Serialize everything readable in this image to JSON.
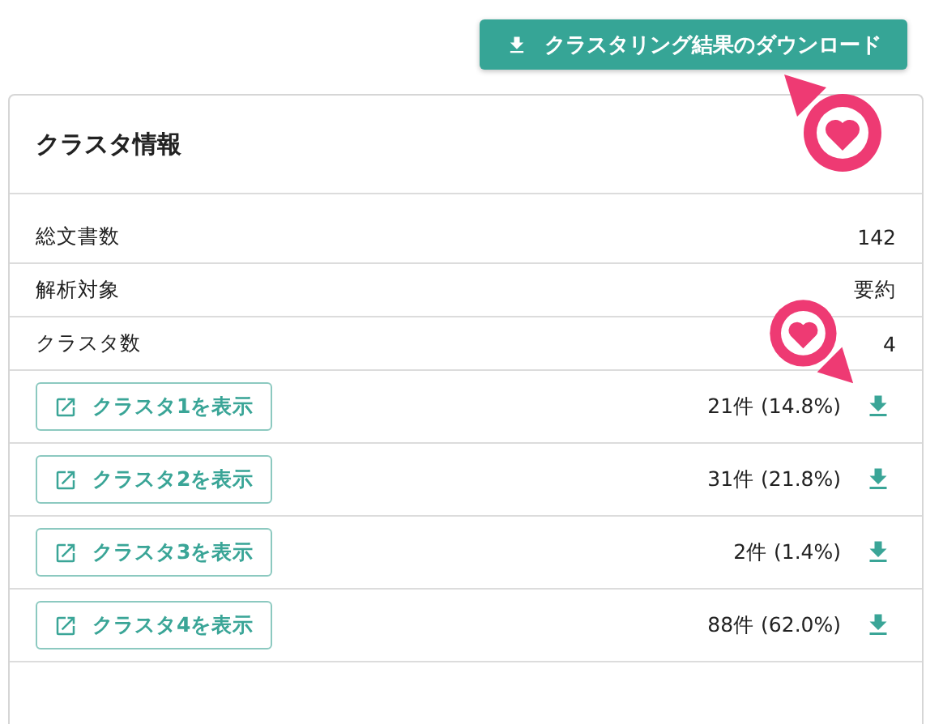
{
  "download_button": {
    "label": "クラスタリング結果のダウンロード"
  },
  "card": {
    "title": "クラスタ情報",
    "info_rows": [
      {
        "label": "総文書数",
        "value": "142"
      },
      {
        "label": "解析対象",
        "value": "要約"
      },
      {
        "label": "クラスタ数",
        "value": "4"
      }
    ],
    "clusters": [
      {
        "button": "クラスタ1を表示",
        "count": "21件 (14.8%)"
      },
      {
        "button": "クラスタ2を表示",
        "count": "31件 (21.8%)"
      },
      {
        "button": "クラスタ3を表示",
        "count": "2件 (1.4%)"
      },
      {
        "button": "クラスタ4を表示",
        "count": "88件 (62.0%)"
      }
    ]
  }
}
